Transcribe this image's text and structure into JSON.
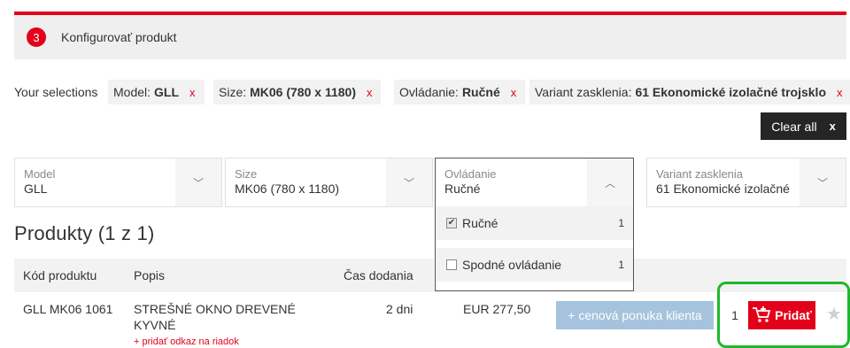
{
  "step": {
    "number": "3",
    "title": "Konfigurovať produkt"
  },
  "selections": {
    "label": "Your selections",
    "chips": [
      {
        "key": "Model:",
        "value": "GLL",
        "remove": "x"
      },
      {
        "key": "Size:",
        "value": "MK06 (780 x 1180)",
        "remove": "x"
      },
      {
        "key": "Ovládanie:",
        "value": "Ručné",
        "remove": "x"
      },
      {
        "key": "Variant zasklenia:",
        "value": "61 Ekonomické izolačné trojsklo",
        "remove": "x"
      }
    ],
    "clear_all": {
      "label": "Clear all",
      "icon": "x"
    }
  },
  "filters": [
    {
      "label": "Model",
      "value": "GLL",
      "icon": "chevron-down-icon",
      "chevron": "﹀"
    },
    {
      "label": "Size",
      "value": "MK06 (780 x 1180)",
      "icon": "chevron-down-icon",
      "chevron": "﹀"
    },
    {
      "label": "Ovládanie",
      "value": "Ručné",
      "icon": "chevron-up-icon",
      "chevron": "︿"
    },
    {
      "label": "Variant zasklenia",
      "value": "61 Ekonomické izolačné",
      "icon": "chevron-down-icon",
      "chevron": "﹀"
    }
  ],
  "dropdown_options": [
    {
      "label": "Ručné",
      "count": "1",
      "checked": true,
      "mark": "✔"
    },
    {
      "label": "Spodné ovládanie",
      "count": "1",
      "checked": false,
      "mark": ""
    }
  ],
  "products": {
    "heading": "Produkty (1 z 1)",
    "columns": {
      "code": "Kód produktu",
      "desc": "Popis",
      "delivery": "Čas dodania"
    },
    "rows": [
      {
        "code": "GLL MK06 1061",
        "desc_line1": "STREŠNÉ OKNO DREVENÉ",
        "desc_line2": "KYVNÉ",
        "link": "+ pridať odkaz na riadok",
        "delivery": "2 dni",
        "price": "EUR 277,50",
        "quote_button": "+ cenová ponuka klienta",
        "qty": "1",
        "add_button": "Pridať",
        "add_icon": "cart-add-icon",
        "star": "★"
      }
    ]
  },
  "colors": {
    "brand_red": "#e3001b",
    "highlight_green": "#1db82e",
    "quote_blue": "#a5c3dd"
  }
}
